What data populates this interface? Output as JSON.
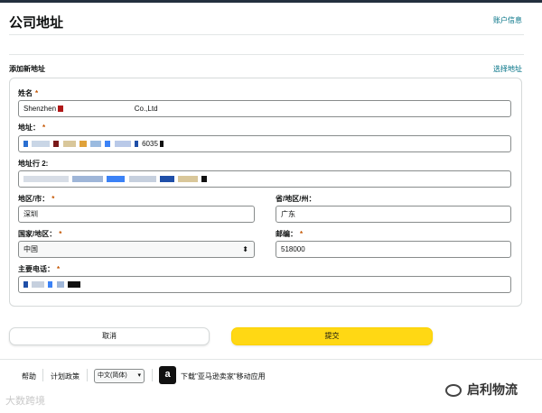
{
  "header": {
    "title": "公司地址",
    "account_link": "账户信息"
  },
  "section": {
    "label": "添加新地址",
    "select_link": "选择地址"
  },
  "form": {
    "required_mark": "*",
    "name": {
      "label": "姓名",
      "value_prefix": "Shenzhen",
      "value_suffix": "Co.,Ltd"
    },
    "address": {
      "label": "地址：",
      "value_suffix": "6035"
    },
    "address2": {
      "label": "地址行 2:"
    },
    "city": {
      "label": "地区/市：",
      "value": "深圳"
    },
    "province": {
      "label": "省/地区/州：",
      "value": "广东"
    },
    "country": {
      "label": "国家/地区：",
      "value": "中国"
    },
    "postal": {
      "label": "邮编：",
      "value": "518000"
    },
    "phone": {
      "label": "主要电话："
    }
  },
  "buttons": {
    "cancel": "取消",
    "submit": "提交"
  },
  "footer": {
    "help": "帮助",
    "privacy": "计划政策",
    "language": "中文(简体)",
    "app_link": "下载\"亚马逊卖家\"移动应用"
  },
  "watermarks": {
    "left": "大数跨境",
    "right": "启利物流"
  },
  "icons": {
    "select_arrow": "updown-arrow-icon",
    "lang_arrow": "chevron-down-icon",
    "app": "amazon-app-icon",
    "wechat": "wechat-icon"
  },
  "colors": {
    "link": "#007185",
    "primary_button": "#ffd814",
    "required": "#c45500",
    "header_bar": "#232f3e"
  }
}
